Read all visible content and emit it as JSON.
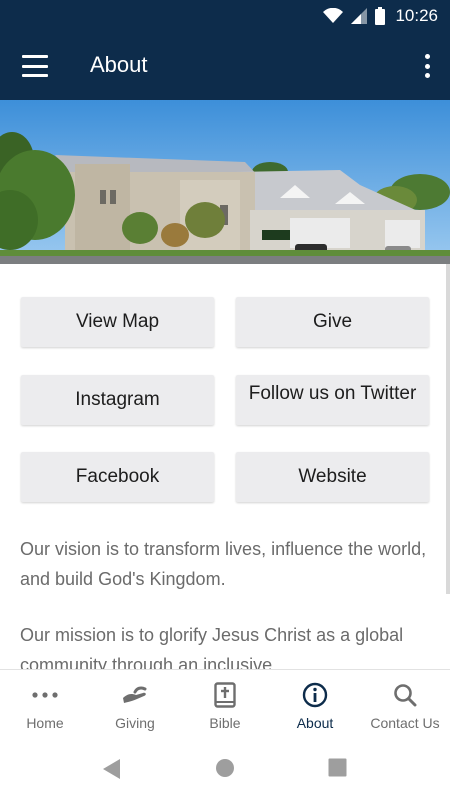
{
  "status_bar": {
    "time": "10:26"
  },
  "app_bar": {
    "title": "About"
  },
  "buttons": [
    {
      "label": "View Map"
    },
    {
      "label": "Give"
    },
    {
      "label": "Instagram"
    },
    {
      "label": "Follow us on Twitter"
    },
    {
      "label": "Facebook"
    },
    {
      "label": "Website"
    }
  ],
  "content": {
    "vision": "Our vision is to transform lives, influence the world, and build God's Kingdom.",
    "mission": "Our mission is to glorify Jesus Christ as a global community through an inclusive,"
  },
  "bottom_nav": [
    {
      "label": "Home",
      "icon": "more-horiz-icon"
    },
    {
      "label": "Giving",
      "icon": "hand-icon"
    },
    {
      "label": "Bible",
      "icon": "bible-icon"
    },
    {
      "label": "About",
      "icon": "info-icon",
      "active": true
    },
    {
      "label": "Contact Us",
      "icon": "search-icon"
    }
  ],
  "colors": {
    "primary": "#0d2c4b",
    "button_bg": "#ececee",
    "body_text": "#6b6b6b",
    "nav_inactive": "#6e6e6e"
  }
}
